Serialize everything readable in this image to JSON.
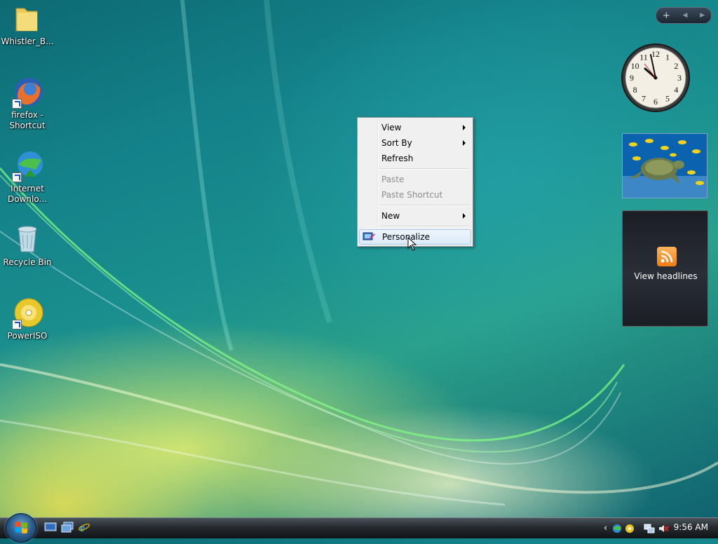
{
  "desktop_icons": [
    {
      "label": "Whistler_B...",
      "icon": "folder-icon"
    },
    {
      "label": "firefox - Shortcut",
      "icon": "firefox-icon"
    },
    {
      "label": "Internet Downlo...",
      "icon": "internet-download-manager-icon"
    },
    {
      "label": "Recycle Bin",
      "icon": "recycle-bin-icon"
    },
    {
      "label": "PowerISO",
      "icon": "poweriso-icon"
    }
  ],
  "context_menu": {
    "items": [
      {
        "label": "View",
        "submenu": true,
        "enabled": true
      },
      {
        "label": "Sort By",
        "submenu": true,
        "enabled": true
      },
      {
        "label": "Refresh",
        "submenu": false,
        "enabled": true
      },
      {
        "label": "Paste",
        "submenu": false,
        "enabled": false
      },
      {
        "label": "Paste Shortcut",
        "submenu": false,
        "enabled": false
      },
      {
        "label": "New",
        "submenu": true,
        "enabled": true
      },
      {
        "label": "Personalize",
        "submenu": false,
        "enabled": true,
        "highlighted": true,
        "icon": "personalize-icon"
      }
    ]
  },
  "sidebar": {
    "controls": {
      "add": "+",
      "prev": "◀",
      "next": "▶"
    },
    "clock_gadget": {
      "numbers": [
        "12",
        "1",
        "2",
        "3",
        "4",
        "5",
        "6",
        "7",
        "8",
        "9",
        "10",
        "11"
      ]
    },
    "slideshow_gadget": {
      "subject": "sea-turtle-photo"
    },
    "feeds_gadget": {
      "label": "View headlines",
      "icon": "rss-feed-icon"
    }
  },
  "taskbar": {
    "start_icon": "windows-start-orb-icon",
    "quick_launch": [
      "show-desktop-icon",
      "switch-windows-icon",
      "internet-explorer-icon"
    ],
    "tray_icons": [
      "show-hidden-icons-chevron",
      "network-status-icon",
      "security-shield-icon",
      "network-icon",
      "volume-muted-icon"
    ],
    "clock": "9:56 AM"
  },
  "colors": {
    "menu_bg": "#f0f0f0",
    "menu_highlight": "#dbe9f9",
    "taskbar": "#1c2025"
  }
}
